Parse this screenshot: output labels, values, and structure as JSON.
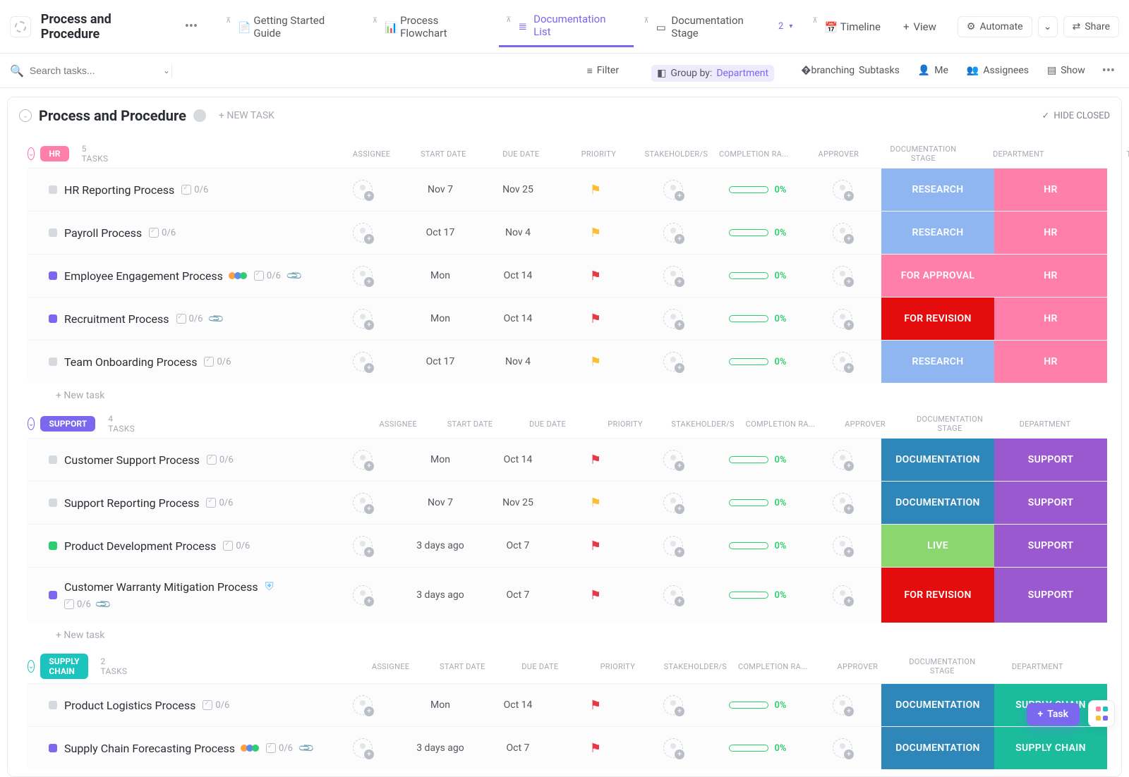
{
  "header": {
    "title": "Process and Procedure",
    "tabs": [
      {
        "label": "Getting Started Guide"
      },
      {
        "label": "Process Flowchart"
      },
      {
        "label": "Documentation List",
        "active": true
      },
      {
        "label": "Documentation Stage",
        "badge": "2"
      },
      {
        "label": "Timeline"
      },
      {
        "label": "View"
      }
    ],
    "automate": "Automate",
    "share": "Share"
  },
  "toolbar": {
    "search_placeholder": "Search tasks...",
    "filter": "Filter",
    "group_label": "Group by:",
    "group_value": "Department",
    "subtasks": "Subtasks",
    "me": "Me",
    "assignees": "Assignees",
    "show": "Show"
  },
  "page": {
    "title": "Process and Procedure",
    "newtask": "+ NEW TASK",
    "hide_closed": "HIDE CLOSED"
  },
  "columns": [
    "ASSIGNEE",
    "START DATE",
    "DUE DATE",
    "PRIORITY",
    "STAKEHOLDER/S",
    "COMPLETION RA...",
    "APPROVER",
    "DOCUMENTATION STAGE",
    "DEPARTMENT",
    "TY"
  ],
  "new_task_label": "+ New task",
  "groups": [
    {
      "name": "HR",
      "pill_class": "hr",
      "chev_class": "pink",
      "count": "5 TASKS",
      "tasks": [
        {
          "status": "sq-grey",
          "name": "HR Reporting Process",
          "sub": "0/6",
          "start": "Nov 7",
          "due": "Nov 25",
          "flag": "yellow",
          "comp": "0%",
          "stage": "RESEARCH",
          "stage_class": "bg-research",
          "dept": "HR",
          "dept_class": "bg-hr"
        },
        {
          "status": "sq-grey",
          "name": "Payroll Process",
          "sub": "0/6",
          "start": "Oct 17",
          "due": "Nov 4",
          "flag": "yellow",
          "comp": "0%",
          "stage": "RESEARCH",
          "stage_class": "bg-research",
          "dept": "HR",
          "dept_class": "bg-hr"
        },
        {
          "status": "sq-purple",
          "name": "Employee Engagement Process",
          "sub": "0/6",
          "clip": true,
          "multi": true,
          "start": "Mon",
          "due": "Oct 14",
          "flag": "red",
          "comp": "0%",
          "stage": "FOR APPROVAL",
          "stage_class": "bg-approval",
          "dept": "HR",
          "dept_class": "bg-hr"
        },
        {
          "status": "sq-purple",
          "name": "Recruitment Process",
          "sub": "0/6",
          "clip": true,
          "start": "Mon",
          "due": "Oct 14",
          "flag": "red",
          "comp": "0%",
          "stage": "FOR REVISION",
          "stage_class": "bg-revision",
          "dept": "HR",
          "dept_class": "bg-hr"
        },
        {
          "status": "sq-grey",
          "name": "Team Onboarding Process",
          "sub": "0/6",
          "start": "Oct 17",
          "due": "Nov 4",
          "flag": "yellow",
          "comp": "0%",
          "stage": "RESEARCH",
          "stage_class": "bg-research",
          "dept": "HR",
          "dept_class": "bg-hr"
        }
      ]
    },
    {
      "name": "SUPPORT",
      "pill_class": "support",
      "chev_class": "purple",
      "count": "4 TASKS",
      "tasks": [
        {
          "status": "sq-grey",
          "name": "Customer Support Process",
          "sub": "0/6",
          "start": "Mon",
          "due": "Oct 14",
          "flag": "red",
          "comp": "0%",
          "stage": "DOCUMENTATION",
          "stage_class": "bg-doc",
          "dept": "SUPPORT",
          "dept_class": "bg-support"
        },
        {
          "status": "sq-grey",
          "name": "Support Reporting Process",
          "sub": "0/6",
          "start": "Nov 7",
          "due": "Nov 25",
          "flag": "yellow",
          "comp": "0%",
          "stage": "DOCUMENTATION",
          "stage_class": "bg-doc",
          "dept": "SUPPORT",
          "dept_class": "bg-support"
        },
        {
          "status": "sq-green",
          "name": "Product Development Process",
          "sub": "0/6",
          "start": "3 days ago",
          "due": "Oct 7",
          "flag": "red",
          "comp": "0%",
          "stage": "LIVE",
          "stage_class": "bg-live",
          "dept": "SUPPORT",
          "dept_class": "bg-support"
        },
        {
          "status": "sq-purple",
          "name": "Customer Warranty Mitigation Process",
          "sub": "0/6",
          "shield": true,
          "clip": true,
          "twoline": true,
          "start": "3 days ago",
          "due": "Oct 7",
          "flag": "red",
          "comp": "0%",
          "stage": "FOR REVISION",
          "stage_class": "bg-revision",
          "dept": "SUPPORT",
          "dept_class": "bg-support"
        }
      ]
    },
    {
      "name": "SUPPLY CHAIN",
      "pill_class": "supply",
      "chev_class": "teal",
      "count": "2 TASKS",
      "tasks": [
        {
          "status": "sq-grey",
          "name": "Product Logistics Process",
          "sub": "0/6",
          "start": "Mon",
          "due": "Oct 14",
          "flag": "red",
          "comp": "0%",
          "stage": "DOCUMENTATION",
          "stage_class": "bg-doc",
          "dept": "SUPPLY CHAIN",
          "dept_class": "bg-supply"
        },
        {
          "status": "sq-purple",
          "name": "Supply Chain Forecasting Process",
          "sub": "0/6",
          "multi": true,
          "clip": true,
          "start": "3 days ago",
          "due": "Oct 7",
          "flag": "red",
          "comp": "0%",
          "stage": "DOCUMENTATION",
          "stage_class": "bg-doc",
          "dept": "SUPPLY CHAIN",
          "dept_class": "bg-supply"
        }
      ]
    }
  ],
  "float_task": "Task"
}
